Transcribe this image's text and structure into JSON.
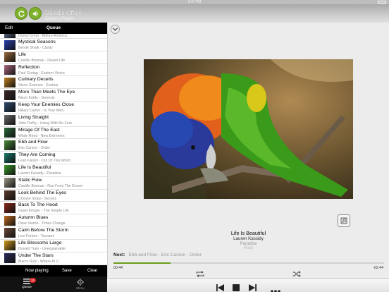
{
  "status_bar": {
    "time": "2:47 PM"
  },
  "header": {
    "zone_name": "David's Office",
    "player_name": "David's Player",
    "sync_icon": "refresh-icon",
    "volume_icon": "speaker-icon",
    "accent": "#7fb22a"
  },
  "queue": {
    "edit_label": "Edit",
    "title": "Queue",
    "items": [
      {
        "title": "",
        "subtitle": "Donny Crest - Before America",
        "color": "#6a7aa0"
      },
      {
        "title": "Mystical Seasons",
        "subtitle": "Bernie Shalk - Clarity",
        "color": "#2a3fb0"
      },
      {
        "title": "Life",
        "subtitle": "Castillo Broman - Desert Life",
        "color": "#9a6a3a"
      },
      {
        "title": "Reflection",
        "subtitle": "Paul Gortag - Eastern Vision",
        "color": "#b06a80"
      },
      {
        "title": "Culinary Deceits",
        "subtitle": "Steve Gunman - Exotica",
        "color": "#c08020"
      },
      {
        "title": "More Than Meets The Eye",
        "subtitle": "Nison Kettle - Genesis",
        "color": "#3a2a2a"
      },
      {
        "title": "Keep Your Enemies Close",
        "subtitle": "Hillary Cantor - In Your Web",
        "color": "#304a70"
      },
      {
        "title": "Living Straight",
        "subtitle": "John Palfry - Living With No Fear",
        "color": "#6a6a6a"
      },
      {
        "title": "Mirage Of The East",
        "subtitle": "Wade Reed - New Extremes",
        "color": "#2a6a3a"
      },
      {
        "title": "Ebb and Flow",
        "subtitle": "Eric Carson - Order",
        "color": "#4a8a3a"
      },
      {
        "title": "They Are Coming",
        "subtitle": "Leah Kantor - Out Of This World",
        "color": "#1a7a6a"
      },
      {
        "title": "Life Is Beautiful",
        "subtitle": "Lauren Kassidy - Paradise",
        "color": "#3a9a2a"
      },
      {
        "title": "Static Flow",
        "subtitle": "Castillo Broman - Run From The Desert",
        "color": "#a09a8a"
      },
      {
        "title": "Look Behind The Eyes",
        "subtitle": "Christie Shaw - Secrets",
        "color": "#5a3a2a"
      },
      {
        "title": "Back To The Hood",
        "subtitle": "David Krisper - The Simple Life",
        "color": "#8a2a1a"
      },
      {
        "title": "Autumn Blues",
        "subtitle": "Dave Vierbe - Times Change",
        "color": "#c06a20"
      },
      {
        "title": "Calm Before The Storm",
        "subtitle": "Levi Forbes - Tsunami",
        "color": "#6a4a3a"
      },
      {
        "title": "Life Blossoms Large",
        "subtitle": "Donald Train - Unexplainable",
        "color": "#d09a20"
      },
      {
        "title": "Under The Stars",
        "subtitle": "Marco Ruiz - Where Ar U",
        "color": "#2a2a5a"
      }
    ],
    "actions": {
      "now_playing": "Now playing",
      "save": "Save",
      "clear": "Clear"
    }
  },
  "tabs": {
    "queue_label": "Queue",
    "queue_badge": "20",
    "menu_label": "Menu"
  },
  "now_playing": {
    "title": "Life Is Beautiful",
    "artist": "Lauren Kassidy",
    "album": "Paradise",
    "genre": "Rock",
    "next_label": "Next:",
    "next_track": "Ebb and Flow - Eric Carson - Order",
    "elapsed": "00:44",
    "remaining": "-02:44",
    "progress_fraction": 0.21
  }
}
